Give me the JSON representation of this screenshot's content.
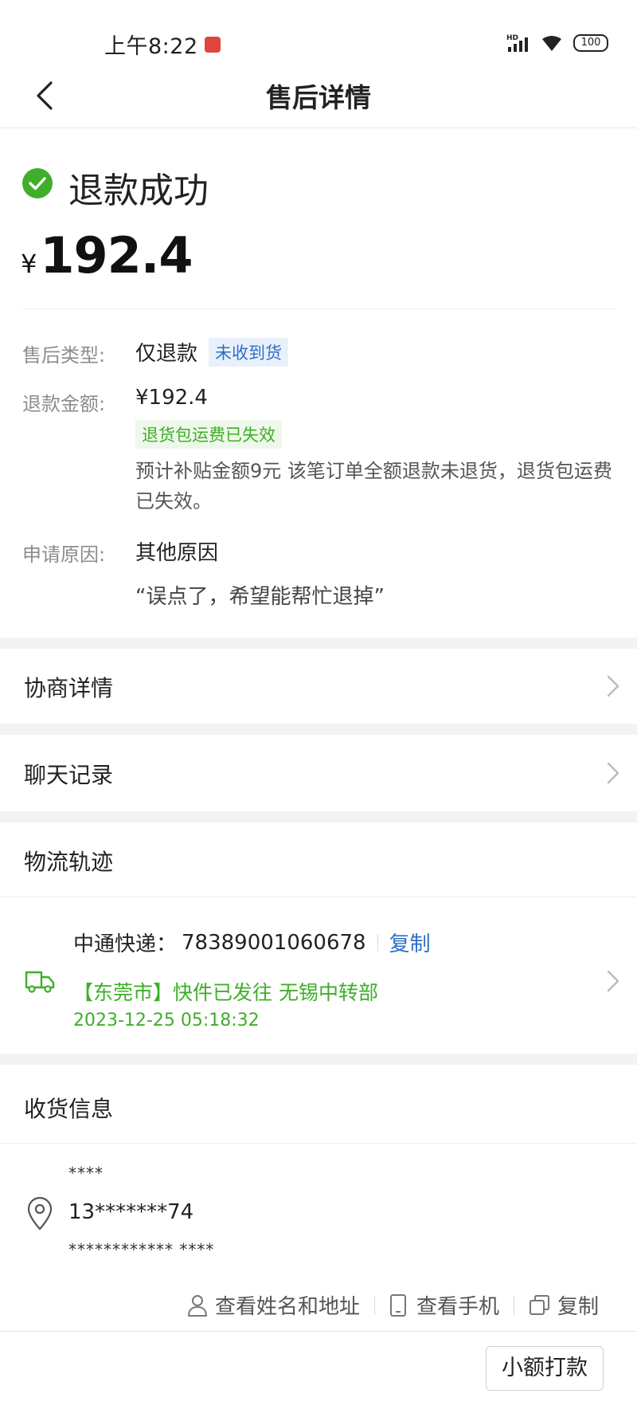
{
  "status_bar": {
    "time": "上午8:22",
    "network": "HD",
    "battery": "100"
  },
  "nav": {
    "title": "售后详情"
  },
  "refund": {
    "status": "退款成功",
    "currency": "¥",
    "amount": "192.4"
  },
  "details": {
    "type_label": "售后类型:",
    "type_value": "仅退款",
    "type_tag": "未收到货",
    "amount_label": "退款金额:",
    "amount_value": "¥192.4",
    "amount_tag": "退货包运费已失效",
    "amount_note": "预计补贴金额9元 该笔订单全额退款未退货，退货包运费已失效。",
    "reason_label": "申请原因:",
    "reason_value": "其他原因",
    "reason_quote": "“误点了，希望能帮忙退掉”"
  },
  "sections": {
    "negotiation": "协商详情",
    "chat": "聊天记录",
    "logistics": "物流轨迹",
    "receiver": "收货信息"
  },
  "logistics": {
    "carrier": "中通快递：",
    "tracking_no": "78389001060678",
    "copy": "复制",
    "event": "【东莞市】快件已发往 无锡中转部",
    "time": "2023-12-25 05:18:32"
  },
  "receiver": {
    "name": "****",
    "phone": "13*******74",
    "address": "************ ****"
  },
  "actions": {
    "view_name_address": "查看姓名和地址",
    "view_phone": "查看手机",
    "copy": "复制"
  },
  "footer": {
    "button": "小额打款"
  },
  "colors": {
    "green": "#3fae2a",
    "blue": "#2f6fc4",
    "gray": "#8d8d8d"
  }
}
